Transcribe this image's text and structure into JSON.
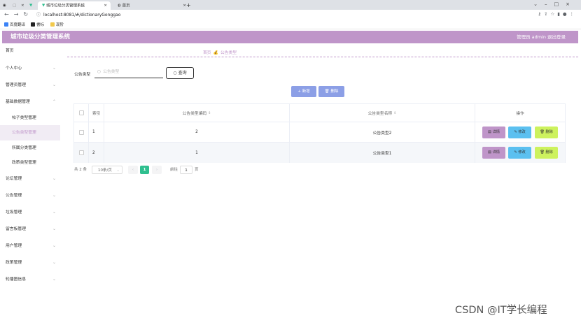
{
  "browser": {
    "tabs": [
      {
        "title": "城市垃圾分类管理系统",
        "active": true
      },
      {
        "title": "首页",
        "active": false
      }
    ],
    "new_tab_label": "+",
    "url": "localhost:8081/#/dictionaryGonggao",
    "bookmarks": [
      "百度翻译",
      "書标",
      "现阶"
    ]
  },
  "app": {
    "title": "城市垃圾分类管理系统",
    "user": "管理员 admin",
    "logout": "退出登录"
  },
  "sidebar": {
    "items": [
      {
        "label": "首页",
        "sub": false,
        "arrow": false
      },
      {
        "label": "个人中心",
        "sub": false,
        "arrow": true
      },
      {
        "label": "管理员管理",
        "sub": false,
        "arrow": true
      },
      {
        "label": "基础数据管理",
        "sub": false,
        "arrow": true
      },
      {
        "label": "帖子类型管理",
        "sub": true,
        "arrow": false
      },
      {
        "label": "公告类型管理",
        "sub": true,
        "arrow": false,
        "selected": true
      },
      {
        "label": "所属分类管理",
        "sub": true,
        "arrow": false
      },
      {
        "label": "政策类型管理",
        "sub": true,
        "arrow": false
      },
      {
        "label": "论坛管理",
        "sub": false,
        "arrow": true
      },
      {
        "label": "公告管理",
        "sub": false,
        "arrow": true
      },
      {
        "label": "垃圾管理",
        "sub": false,
        "arrow": true
      },
      {
        "label": "留言板管理",
        "sub": false,
        "arrow": true
      },
      {
        "label": "用户管理",
        "sub": false,
        "arrow": true
      },
      {
        "label": "政策管理",
        "sub": false,
        "arrow": true
      },
      {
        "label": "轮播图信息",
        "sub": false,
        "arrow": true
      }
    ]
  },
  "breadcrumb": {
    "home": "首页",
    "current": "公告类型"
  },
  "search": {
    "label": "公告类型",
    "placeholder": "公告类型",
    "query_button": "查询"
  },
  "actions": {
    "add": "新增",
    "delete": "删除"
  },
  "table": {
    "headers": {
      "index": "索引",
      "code": "公告类型编码",
      "name": "公告类型名称",
      "ops": "操作"
    },
    "rows": [
      {
        "index": "1",
        "code": "2",
        "name": "公告类型2"
      },
      {
        "index": "2",
        "code": "1",
        "name": "公告类型1"
      }
    ],
    "op_labels": {
      "detail": "详情",
      "edit": "修改",
      "delete": "删除"
    }
  },
  "pagination": {
    "total": "共 2 条",
    "page_size": "10条/页",
    "current_page": "1",
    "goto_label": "前往",
    "goto_value": "1",
    "page_suffix": "页"
  },
  "watermark": "CSDN @IT学长编程",
  "colors": {
    "header_bg": "#bf95c9",
    "primary_btn": "#8c9fe6",
    "detail_btn": "#bf95c9",
    "edit_btn": "#5bc0f0",
    "delete_btn": "#cdf25e",
    "pager_active": "#2fbf8f"
  }
}
